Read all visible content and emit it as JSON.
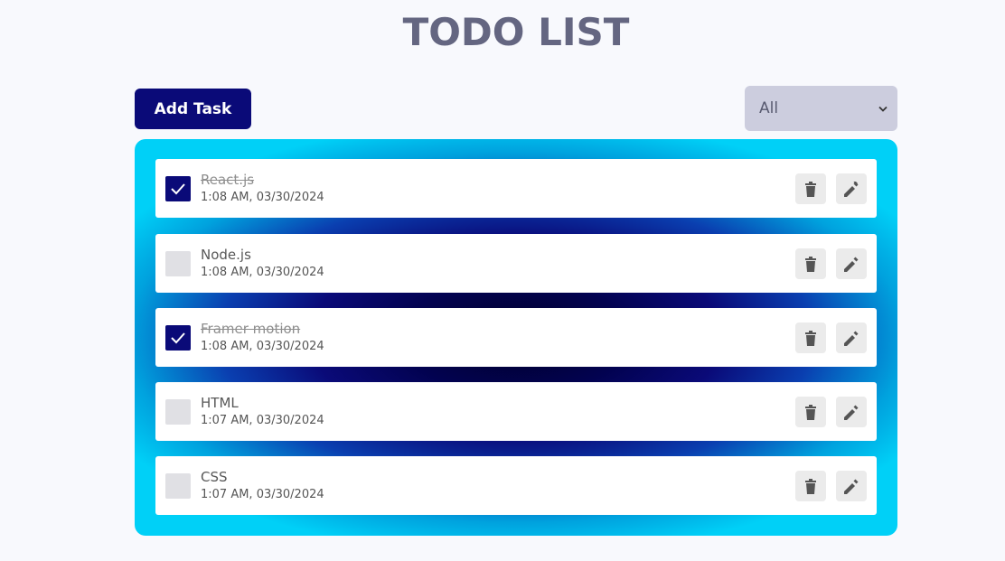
{
  "title": "TODO LIST",
  "toolbar": {
    "add_label": "Add Task",
    "filter_selected": "All"
  },
  "colors": {
    "primary": "#0a0a78",
    "title": "#646681",
    "filter_bg": "#cccdde",
    "board_edge": "#00d0f7",
    "board_center": "#000027"
  },
  "icons": {
    "checkbox_checked": "check-icon",
    "delete": "trash-icon",
    "edit": "pencil-icon",
    "filter": "chevron-down-icon"
  },
  "tasks": [
    {
      "title": "React.js",
      "time": "1:08 AM, 03/30/2024",
      "completed": true
    },
    {
      "title": "Node.js",
      "time": "1:08 AM, 03/30/2024",
      "completed": false
    },
    {
      "title": "Framer motion",
      "time": "1:08 AM, 03/30/2024",
      "completed": true
    },
    {
      "title": "HTML",
      "time": "1:07 AM, 03/30/2024",
      "completed": false
    },
    {
      "title": "CSS",
      "time": "1:07 AM, 03/30/2024",
      "completed": false
    }
  ]
}
